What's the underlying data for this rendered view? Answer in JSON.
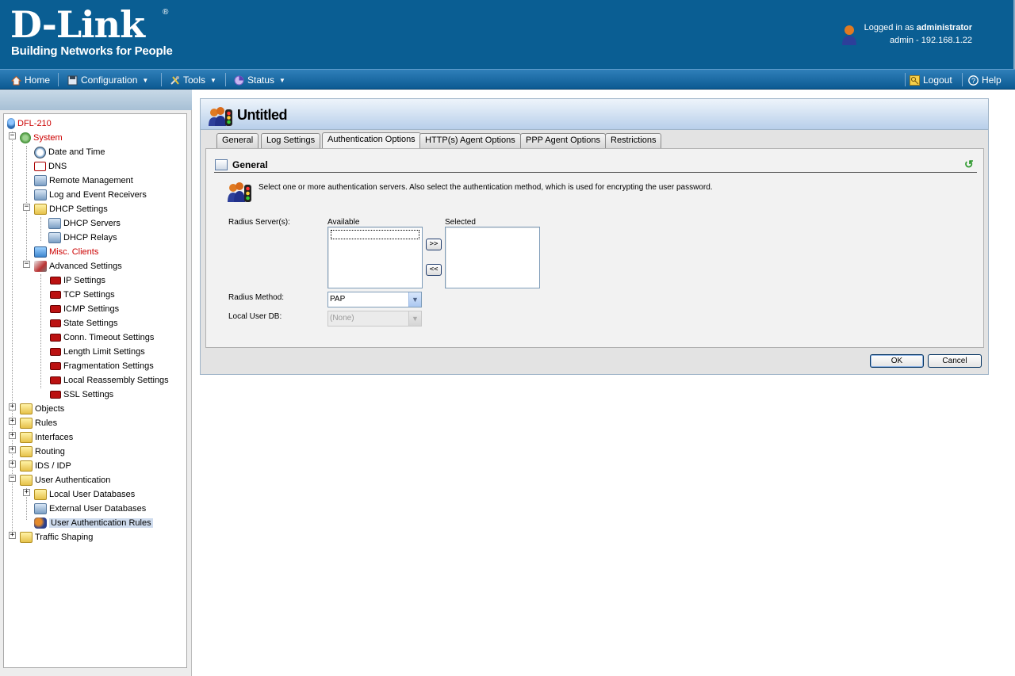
{
  "header": {
    "logo_text": "D-Link",
    "logo_tagline": "Building Networks for People",
    "login_prefix": "Logged in as ",
    "login_user": "administrator",
    "login_detail": "admin - 192.168.1.22"
  },
  "menubar": {
    "home": "Home",
    "configuration": "Configuration",
    "tools": "Tools",
    "status": "Status",
    "logout": "Logout",
    "help": "Help"
  },
  "tree": {
    "root": "DFL-210",
    "system": "System",
    "date_time": "Date and Time",
    "dns": "DNS",
    "remote_mgmt": "Remote Management",
    "log_receivers": "Log and Event Receivers",
    "dhcp_settings": "DHCP Settings",
    "dhcp_servers": "DHCP Servers",
    "dhcp_relays": "DHCP Relays",
    "misc_clients": "Misc. Clients",
    "advanced_settings": "Advanced Settings",
    "ip_settings": "IP Settings",
    "tcp_settings": "TCP Settings",
    "icmp_settings": "ICMP Settings",
    "state_settings": "State Settings",
    "conn_timeout": "Conn. Timeout Settings",
    "length_limit": "Length Limit Settings",
    "fragmentation": "Fragmentation Settings",
    "local_reassembly": "Local Reassembly Settings",
    "ssl_settings": "SSL Settings",
    "objects": "Objects",
    "rules": "Rules",
    "interfaces": "Interfaces",
    "routing": "Routing",
    "ids_idp": "IDS / IDP",
    "user_auth": "User Authentication",
    "local_user_db": "Local User Databases",
    "external_user_db": "External User Databases",
    "user_auth_rules": "User Authentication Rules",
    "traffic_shaping": "Traffic Shaping"
  },
  "content": {
    "title": "Untitled",
    "tabs": [
      "General",
      "Log Settings",
      "Authentication Options",
      "HTTP(s) Agent Options",
      "PPP Agent Options",
      "Restrictions"
    ],
    "active_tab": "Authentication Options",
    "section_title": "General",
    "info_text": "Select one or more authentication servers. Also select the authentication method, which is used for encrypting the user password.",
    "radius_servers_label": "Radius Server(s):",
    "available_label": "Available",
    "selected_label": "Selected",
    "add_button": ">>",
    "remove_button": "<<",
    "radius_method_label": "Radius Method:",
    "radius_method_value": "PAP",
    "local_user_db_label": "Local User DB:",
    "local_user_db_value": "(None)",
    "ok_button": "OK",
    "cancel_button": "Cancel"
  }
}
